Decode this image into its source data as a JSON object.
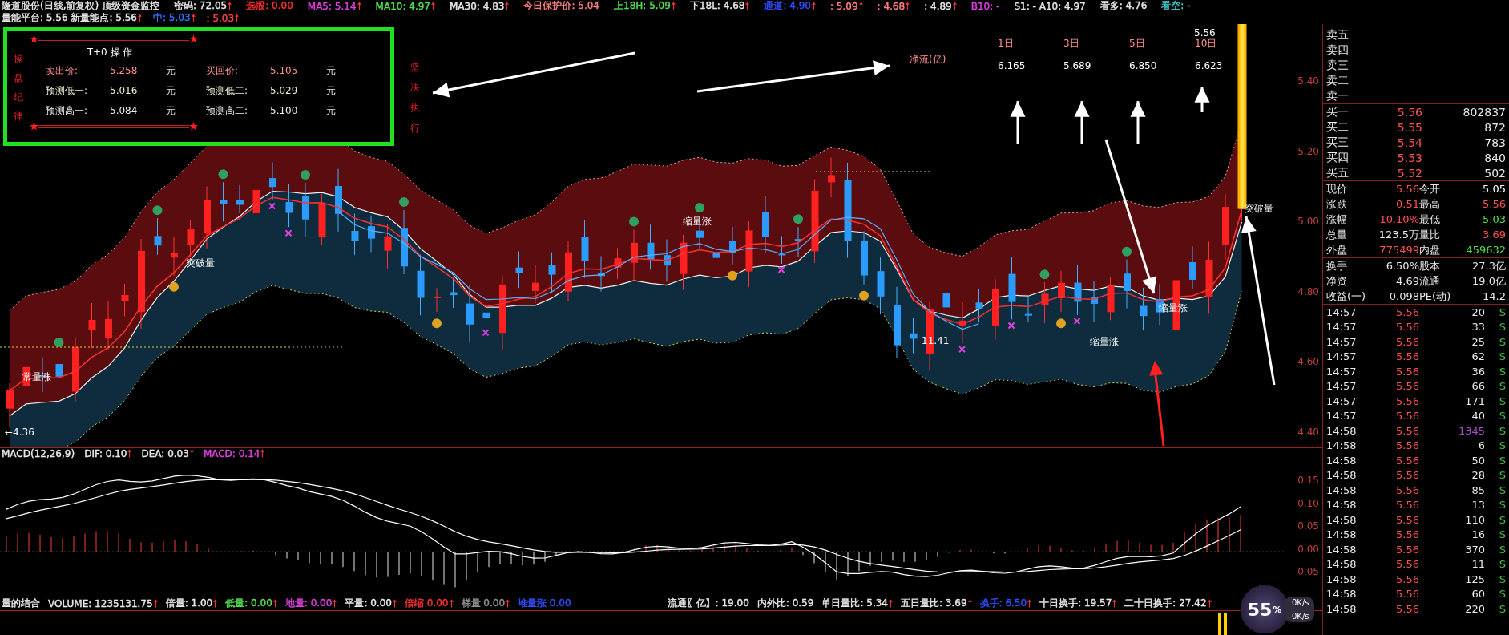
{
  "header": {
    "row1": [
      {
        "text": "隆道股份(日线,前复权) 顶级资金监控",
        "color": "#e8e8e8",
        "up_arrow": false
      },
      {
        "text": "密码: 72.05",
        "color": "#e8e8e8",
        "up_arrow": true
      },
      {
        "text": "选股: 0.00",
        "color": "#ff3030",
        "up_arrow": false
      },
      {
        "text": "MA5: 5.14",
        "color": "#e040e0",
        "up_arrow": true
      },
      {
        "text": "MA10: 4.97",
        "color": "#50e050",
        "up_arrow": true
      },
      {
        "text": "MA30: 4.83",
        "color": "#e8e8e8",
        "up_arrow": true
      },
      {
        "text": "今日保护价: 5.04",
        "color": "#ff8080",
        "up_arrow": false
      },
      {
        "text": "上18H: 5.09",
        "color": "#50e050",
        "up_arrow": true
      },
      {
        "text": "下18L: 4.68",
        "color": "#e8e8e8",
        "up_arrow": true
      },
      {
        "text": "通道: 4.90",
        "color": "#3050ff",
        "up_arrow": true
      },
      {
        "text": ": 5.09",
        "color": "#ff8080",
        "up_arrow": true
      },
      {
        "text": ": 4.68",
        "color": "#ff8080",
        "up_arrow": true
      },
      {
        "text": ": 4.89",
        "color": "#e8e8e8",
        "up_arrow": true
      },
      {
        "text": "B10: -",
        "color": "#e040e0",
        "up_arrow": false
      },
      {
        "text": "S1: - A10: 4.97",
        "color": "#e8e8e8",
        "up_arrow": false
      },
      {
        "text": "看多: 4.76",
        "color": "#e8e8e8",
        "up_arrow": false
      },
      {
        "text": "看空: -",
        "color": "#40d0d0",
        "up_arrow": false
      }
    ],
    "row2": [
      {
        "text": "量能平台: 5.56 新量能点: 5.56",
        "color": "#e8e8e8",
        "up_arrow": true
      },
      {
        "text": "中: 5.03",
        "color": "#3070ff",
        "up_arrow": true
      },
      {
        "text": ": 5.03",
        "color": "#ff4040",
        "up_arrow": true
      }
    ]
  },
  "info_box": {
    "side_label": "操盘纪律",
    "title": "T+0 操 作",
    "rows": [
      {
        "color": "#ff9090",
        "cells": [
          {
            "label": "卖出价:",
            "value": "5.258",
            "unit": "元"
          },
          {
            "label": "买回价:",
            "value": "5.105",
            "unit": "元"
          }
        ]
      },
      {
        "color": "#f0f0d0",
        "cells": [
          {
            "label": "预测低一:",
            "value": "5.016",
            "unit": "元"
          },
          {
            "label": "预测低二:",
            "value": "5.029",
            "unit": "元"
          }
        ]
      },
      {
        "color": "#f0f0f0",
        "cells": [
          {
            "label": "预测高一:",
            "value": "5.084",
            "unit": "元"
          },
          {
            "label": "预测高二:",
            "value": "5.100",
            "unit": "元"
          }
        ]
      }
    ]
  },
  "side_note": "坚决执行",
  "net_flow": {
    "label": "净流(亿)",
    "columns": [
      {
        "period": "1日",
        "value": "6.165"
      },
      {
        "period": "3日",
        "value": "5.689"
      },
      {
        "period": "5日",
        "value": "6.850"
      },
      {
        "period": "10日",
        "value": "6.623"
      }
    ]
  },
  "annotations": [
    {
      "text": "突破量"
    },
    {
      "text": "突破量"
    },
    {
      "text": "缩量涨"
    },
    {
      "text": "缩量涨"
    },
    {
      "text": "缩量涨"
    },
    {
      "text": "常量涨"
    },
    {
      "text": "11.41"
    },
    {
      "text": "←4.36"
    },
    {
      "text": "5.56"
    }
  ],
  "price_axis": [
    "5.40",
    "5.20",
    "5.00",
    "4.80",
    "4.60",
    "4.40"
  ],
  "macd": {
    "header": [
      {
        "text": "MACD(12,26,9)",
        "color": "#e8e8e8",
        "up_arrow": false
      },
      {
        "text": "DIF: 0.10",
        "color": "#e8e8e8",
        "up_arrow": true
      },
      {
        "text": "DEA: 0.03",
        "color": "#e8e8e8",
        "up_arrow": true
      },
      {
        "text": "MACD: 0.14",
        "color": "#e040e0",
        "up_arrow": true
      }
    ],
    "axis": [
      "0.15",
      "0.10",
      "0.05",
      "0.00",
      "-0.05"
    ]
  },
  "volume_bar": {
    "left": [
      {
        "text": "量的结合",
        "color": "#e8e8e8",
        "up_arrow": false
      },
      {
        "text": "VOLUME: 1235131.75",
        "color": "#e8e8e8",
        "up_arrow": true
      },
      {
        "text": "倍量: 1.00",
        "color": "#e8e8e8",
        "up_arrow": true
      },
      {
        "text": "低量: 0.00",
        "color": "#50e050",
        "up_arrow": true
      },
      {
        "text": "地量: 0.00",
        "color": "#e040e0",
        "up_arrow": true
      },
      {
        "text": "平量: 0.00",
        "color": "#e8e8e8",
        "up_arrow": true
      },
      {
        "text": "倍缩 0.00",
        "color": "#ff3030",
        "up_arrow": true
      },
      {
        "text": "梯量 0.00",
        "color": "#909090",
        "up_arrow": true
      },
      {
        "text": "堆量涨 0.00",
        "color": "#3050ff",
        "up_arrow": false
      }
    ],
    "right": [
      {
        "text": "流通〖亿〗: 19.00",
        "color": "#e8e8e8",
        "up_arrow": false
      },
      {
        "text": "内外比: 0.59",
        "color": "#e8e8e8",
        "up_arrow": false
      },
      {
        "text": "单日量比: 5.34",
        "color": "#e8e8e8",
        "up_arrow": true
      },
      {
        "text": "五日量比: 3.69",
        "color": "#e8e8e8",
        "up_arrow": true
      },
      {
        "text": "换手: 6.50",
        "color": "#3050ff",
        "up_arrow": true
      },
      {
        "text": "十日换手: 19.57",
        "color": "#e8e8e8",
        "up_arrow": true
      },
      {
        "text": "二十日换手: 27.42",
        "color": "#e8e8e8",
        "up_arrow": true
      }
    ]
  },
  "order_book": {
    "sell": [
      "卖五",
      "卖四",
      "卖三",
      "卖二",
      "卖一"
    ],
    "buy": [
      {
        "label": "买一",
        "price": "5.56",
        "volume": "802837"
      },
      {
        "label": "买二",
        "price": "5.55",
        "volume": "872"
      },
      {
        "label": "买三",
        "price": "5.54",
        "volume": "783"
      },
      {
        "label": "买四",
        "price": "5.53",
        "volume": "840"
      },
      {
        "label": "买五",
        "price": "5.52",
        "volume": "502"
      }
    ]
  },
  "quote": [
    [
      {
        "label": "现价",
        "value": "5.56",
        "color": "#ff5050"
      },
      {
        "label": "今开",
        "value": "5.05",
        "color": "#ffffff"
      }
    ],
    [
      {
        "label": "涨跌",
        "value": "0.51",
        "color": "#ff5050"
      },
      {
        "label": "最高",
        "value": "5.56",
        "color": "#ff5050"
      }
    ],
    [
      {
        "label": "涨幅",
        "value": "10.10%",
        "color": "#ff5050"
      },
      {
        "label": "最低",
        "value": "5.03",
        "color": "#50e050"
      }
    ],
    [
      {
        "label": "总量",
        "value": "123.5万",
        "color": "#e8e8e8"
      },
      {
        "label": "量比",
        "value": "3.69",
        "color": "#ff5050"
      }
    ],
    [
      {
        "label": "外盘",
        "value": "775499",
        "color": "#ff5050"
      },
      {
        "label": "内盘",
        "value": "459632",
        "color": "#50e050"
      }
    ]
  ],
  "fundamentals": [
    [
      {
        "label": "换手",
        "value": "6.50%"
      },
      {
        "label": "股本",
        "value": "27.3亿"
      }
    ],
    [
      {
        "label": "净资",
        "value": "4.69"
      },
      {
        "label": "流通",
        "value": "19.0亿"
      }
    ],
    [
      {
        "label": "收益(一)",
        "value": "0.098"
      },
      {
        "label": "PE(动)",
        "value": "14.2"
      }
    ]
  ],
  "ticks": [
    {
      "time": "14:57",
      "price": "5.56",
      "volume": "20",
      "side": "S",
      "color": "#e8e8e8"
    },
    {
      "time": "14:57",
      "price": "5.56",
      "volume": "33",
      "side": "S",
      "color": "#e8e8e8"
    },
    {
      "time": "14:57",
      "price": "5.56",
      "volume": "25",
      "side": "S",
      "color": "#e8e8e8"
    },
    {
      "time": "14:57",
      "price": "5.56",
      "volume": "62",
      "side": "S",
      "color": "#e8e8e8"
    },
    {
      "time": "14:57",
      "price": "5.56",
      "volume": "36",
      "side": "S",
      "color": "#e8e8e8"
    },
    {
      "time": "14:57",
      "price": "5.56",
      "volume": "66",
      "side": "S",
      "color": "#e8e8e8"
    },
    {
      "time": "14:57",
      "price": "5.56",
      "volume": "171",
      "side": "S",
      "color": "#e8e8e8"
    },
    {
      "time": "14:57",
      "price": "5.56",
      "volume": "40",
      "side": "S",
      "color": "#e8e8e8"
    },
    {
      "time": "14:58",
      "price": "5.56",
      "volume": "1345",
      "side": "S",
      "color": "#a050c0"
    },
    {
      "time": "14:58",
      "price": "5.56",
      "volume": "6",
      "side": "S",
      "color": "#e8e8e8"
    },
    {
      "time": "14:58",
      "price": "5.56",
      "volume": "50",
      "side": "S",
      "color": "#e8e8e8"
    },
    {
      "time": "14:58",
      "price": "5.56",
      "volume": "28",
      "side": "S",
      "color": "#e8e8e8"
    },
    {
      "time": "14:58",
      "price": "5.56",
      "volume": "85",
      "side": "S",
      "color": "#e8e8e8"
    },
    {
      "time": "14:58",
      "price": "5.56",
      "volume": "13",
      "side": "S",
      "color": "#e8e8e8"
    },
    {
      "time": "14:58",
      "price": "5.56",
      "volume": "110",
      "side": "S",
      "color": "#e8e8e8"
    },
    {
      "time": "14:58",
      "price": "5.56",
      "volume": "16",
      "side": "S",
      "color": "#e8e8e8"
    },
    {
      "time": "14:58",
      "price": "5.56",
      "volume": "370",
      "side": "S",
      "color": "#e8e8e8"
    },
    {
      "time": "14:58",
      "price": "5.56",
      "volume": "11",
      "side": "S",
      "color": "#e8e8e8"
    },
    {
      "time": "14:58",
      "price": "5.56",
      "volume": "125",
      "side": "S",
      "color": "#e8e8e8"
    },
    {
      "time": "14:58",
      "price": "5.56",
      "volume": "60",
      "side": "S",
      "color": "#e8e8e8"
    },
    {
      "time": "14:58",
      "price": "5.56",
      "volume": "220",
      "side": "S",
      "color": "#e8e8e8"
    }
  ],
  "speed_widget": {
    "percent": "55",
    "unit": "%",
    "rates": [
      "0K/s",
      "0K/s"
    ]
  }
}
